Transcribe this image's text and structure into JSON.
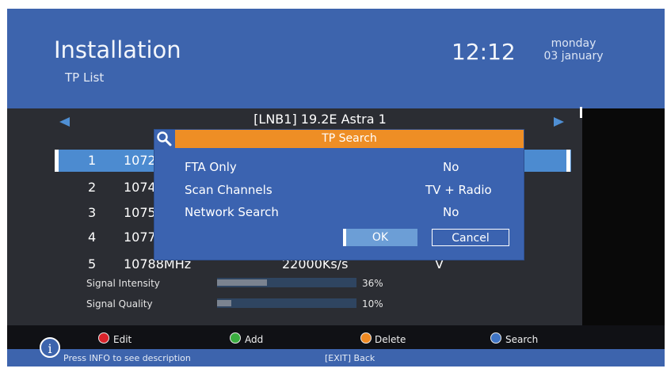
{
  "header": {
    "title": "Installation",
    "subtitle": "TP List",
    "time": "12:12",
    "day": "monday",
    "date": "03 january"
  },
  "satellite": {
    "name": "[LNB1] 19.2E Astra 1"
  },
  "transponders": [
    {
      "num": "1",
      "freq": "1072"
    },
    {
      "num": "2",
      "freq": "1074"
    },
    {
      "num": "3",
      "freq": "1075"
    },
    {
      "num": "4",
      "freq": "1077"
    },
    {
      "num": "5",
      "freq": "10788MHz",
      "symbol_rate": "22000Ks/s",
      "polarity": "V"
    }
  ],
  "signal": {
    "intensity_label": "Signal Intensity",
    "intensity_value": "36%",
    "intensity_fraction": 0.36,
    "quality_label": "Signal Quality",
    "quality_value": "10%",
    "quality_fraction": 0.1
  },
  "dialog": {
    "title": "TP Search",
    "fields": [
      {
        "label": "FTA Only",
        "value": "No"
      },
      {
        "label": "Scan Channels",
        "value": "TV + Radio"
      },
      {
        "label": "Network Search",
        "value": "No"
      }
    ],
    "ok_label": "OK",
    "cancel_label": "Cancel"
  },
  "legend": {
    "edit": "Edit",
    "add": "Add",
    "delete": "Delete",
    "search": "Search",
    "colors": {
      "edit": "#d9232b",
      "add": "#3aad3f",
      "delete": "#f08a22",
      "search": "#3f74c4"
    }
  },
  "footer": {
    "info_hint": "Press INFO to see description",
    "exit_hint": "[EXIT] Back"
  }
}
